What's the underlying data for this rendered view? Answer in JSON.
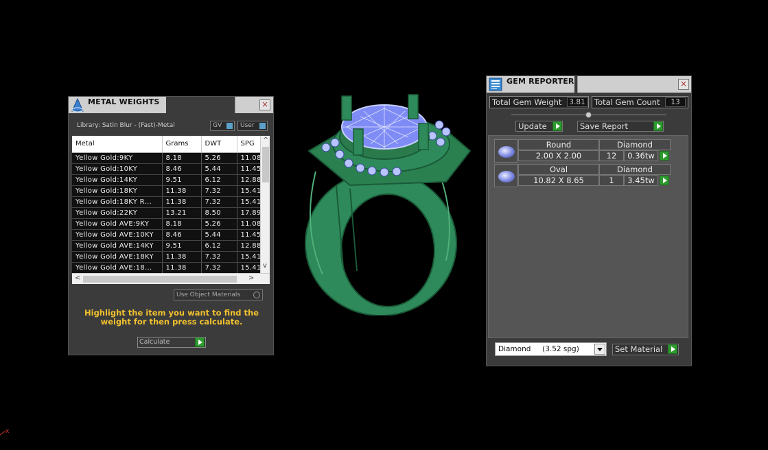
{
  "metal_weights": {
    "title": "METAL WEIGHTS",
    "library": "Library: Satin Blur - (Fast)-Metal",
    "toggle_gv": "GV",
    "toggle_user": "User",
    "columns": [
      "Metal",
      "Grams",
      "DWT",
      "SPG"
    ],
    "rows": [
      [
        "Yellow Gold:9KY",
        "8.18",
        "5.26",
        "11.08"
      ],
      [
        "Yellow Gold:10KY",
        "8.46",
        "5.44",
        "11.45"
      ],
      [
        "Yellow Gold:14KY",
        "9.51",
        "6.12",
        "12.88"
      ],
      [
        "Yellow Gold:18KY",
        "11.38",
        "7.32",
        "15.41"
      ],
      [
        "Yellow Gold:18KY R...",
        "11.38",
        "7.32",
        "15.41"
      ],
      [
        "Yellow Gold:22KY",
        "13.21",
        "8.50",
        "17.89"
      ],
      [
        "Yellow Gold AVE:9KY",
        "8.18",
        "5.26",
        "11.08"
      ],
      [
        "Yellow Gold AVE:10KY",
        "8.46",
        "5.44",
        "11.45"
      ],
      [
        "Yellow Gold AVE:14KY",
        "9.51",
        "6.12",
        "12.88"
      ],
      [
        "Yellow Gold AVE:18KY",
        "11.38",
        "7.32",
        "15.41"
      ],
      [
        "Yellow Gold AVE:18...",
        "11.38",
        "7.32",
        "15.41"
      ]
    ],
    "use_object_materials": "Use Object Materials",
    "hint": "Highlight the item you want to find the weight for then press calculate.",
    "calculate_label": "Calculate"
  },
  "gem_reporter": {
    "title": "GEM REPORTER",
    "total_weight_label": "Total Gem Weight",
    "total_weight_value": "3.81",
    "total_count_label": "Total Gem Count",
    "total_count_value": "13",
    "update_label": "Update",
    "save_report_label": "Save Report",
    "gems": [
      {
        "shape": "Round",
        "material": "Diamond",
        "size": "2.00 X 2.00",
        "count": "12",
        "weight": "0.36tw"
      },
      {
        "shape": "Oval",
        "material": "Diamond",
        "size": "10.82 X 8.65",
        "count": "1",
        "weight": "3.45tw"
      }
    ],
    "material_select": "Diamond     (3.52 spg)",
    "set_material_label": "Set Material"
  },
  "viewport": {
    "model": "ring-3d-wireframe",
    "colors": {
      "metal": "#2e8a5a",
      "gem": "#7f8cf5",
      "background": "#000000"
    },
    "axis_label": "x"
  }
}
